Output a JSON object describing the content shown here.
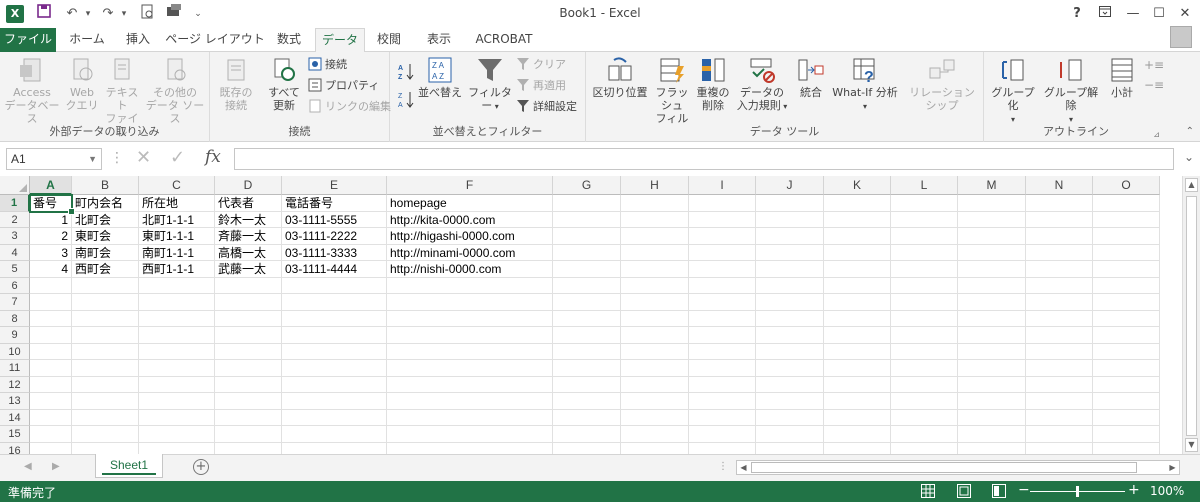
{
  "window": {
    "title": "Book1 - Excel",
    "help": "?",
    "restore_ribbon": "⊡",
    "minimize": "—",
    "maximize": "☐",
    "close": "✕"
  },
  "qat": {
    "save": "💾",
    "undo": "↶",
    "redo": "↷",
    "more": "⌄"
  },
  "tabs": [
    "ファイル",
    "ホーム",
    "挿入",
    "ページ レイアウト",
    "数式",
    "データ",
    "校閲",
    "表示",
    "ACROBAT"
  ],
  "active_tab": "データ",
  "ribbon": {
    "g1": {
      "label": "外部データの取り込み",
      "b1": "Access",
      "b1b": "データベース",
      "b2": "Web",
      "b2b": "クエリ",
      "b3": "テキスト",
      "b3b": "ファイル",
      "b4": "その他の",
      "b4b": "データ ソース"
    },
    "g2": {
      "label": "接続",
      "b1": "既存の",
      "b1b": "接続",
      "b2": "すべて",
      "b2b": "更新",
      "s1": "接続",
      "s2": "プロパティ",
      "s3": "リンクの編集"
    },
    "g3": {
      "label": "並べ替えとフィルター",
      "sort": "並べ替え",
      "filter": "フィルター",
      "s1": "クリア",
      "s2": "再適用",
      "s3": "詳細設定"
    },
    "g4": {
      "label": "データ ツール",
      "b1": "区切り位置",
      "b2": "フラッシュ",
      "b2b": "フィル",
      "b3": "重複の",
      "b3b": "削除",
      "b4": "データの",
      "b4b": "入力規則",
      "b5": "統合",
      "b6": "What-If 分析",
      "b7": "リレーションシップ"
    },
    "g5": {
      "label": "アウトライン",
      "b1": "グループ化",
      "b2": "グループ解除",
      "b3": "小計"
    }
  },
  "formula": {
    "namebox": "A1",
    "fx": "fx",
    "value": ""
  },
  "columns": [
    "A",
    "B",
    "C",
    "D",
    "E",
    "F",
    "G",
    "H",
    "I",
    "J",
    "K",
    "L",
    "M",
    "N",
    "O"
  ],
  "selected_cell": "A1",
  "rows": [
    [
      "番号",
      "町内会名",
      "所在地",
      "代表者",
      "電話番号",
      "homepage"
    ],
    [
      "1",
      "北町会",
      "北町1-1-1",
      "鈴木一太",
      "03-1111-5555",
      "http://kita-0000.com"
    ],
    [
      "2",
      "東町会",
      "東町1-1-1",
      "斉藤一太",
      "03-1111-2222",
      "http://higashi-0000.com"
    ],
    [
      "3",
      "南町会",
      "南町1-1-1",
      "高橋一太",
      "03-1111-3333",
      "http://minami-0000.com"
    ],
    [
      "4",
      "西町会",
      "西町1-1-1",
      "武藤一太",
      "03-1111-4444",
      "http://nishi-0000.com"
    ]
  ],
  "row_numbers": [
    "1",
    "2",
    "3",
    "4",
    "5",
    "6",
    "7",
    "8",
    "9",
    "10",
    "11",
    "12",
    "13",
    "14",
    "15",
    "16"
  ],
  "sheets": [
    "Sheet1"
  ],
  "status": {
    "ready": "準備完了",
    "zoom": "100%",
    "minus": "−",
    "plus": "+"
  },
  "colors": {
    "accent": "#217346"
  }
}
